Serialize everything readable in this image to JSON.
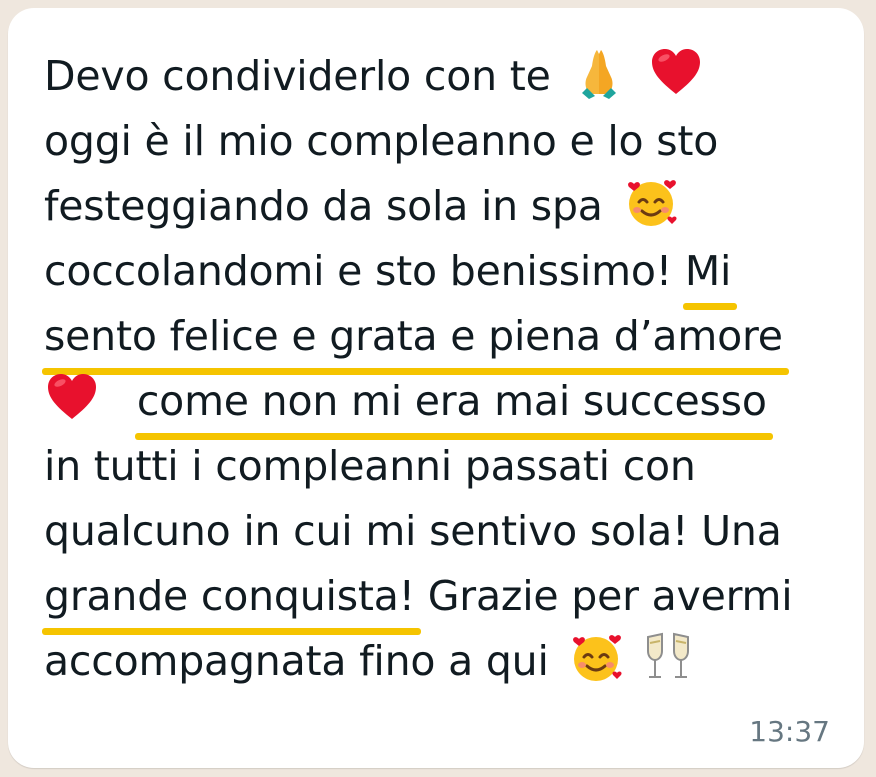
{
  "message": {
    "line1": "Devo condividerlo con te",
    "line2": "oggi è il mio compleanno e lo sto",
    "line3": "festeggiando da sola in spa",
    "line4a": "coccolandomi e sto benissimo!",
    "line4b": "Mi",
    "line5": "sento felice e grata e piena d’amore",
    "line6b": "come non mi era mai successo",
    "line7": "in tutti i compleanni passati con",
    "line8": "qualcuno in cui mi sentivo sola! Una",
    "line9a": "grande conquista!",
    "line9b": "Grazie per avermi",
    "line10": "accompagnata fino a qui",
    "time": "13:37"
  },
  "icons": {
    "pray": "folded-hands-icon",
    "heart": "red-heart-icon",
    "hearts_face": "smiling-face-with-hearts-icon",
    "champagne": "clinking-glasses-icon"
  },
  "colors": {
    "highlight": "#f5c400",
    "bubble": "#ffffff",
    "text": "#111b21",
    "meta": "#667781",
    "heart": "#e8112d"
  }
}
